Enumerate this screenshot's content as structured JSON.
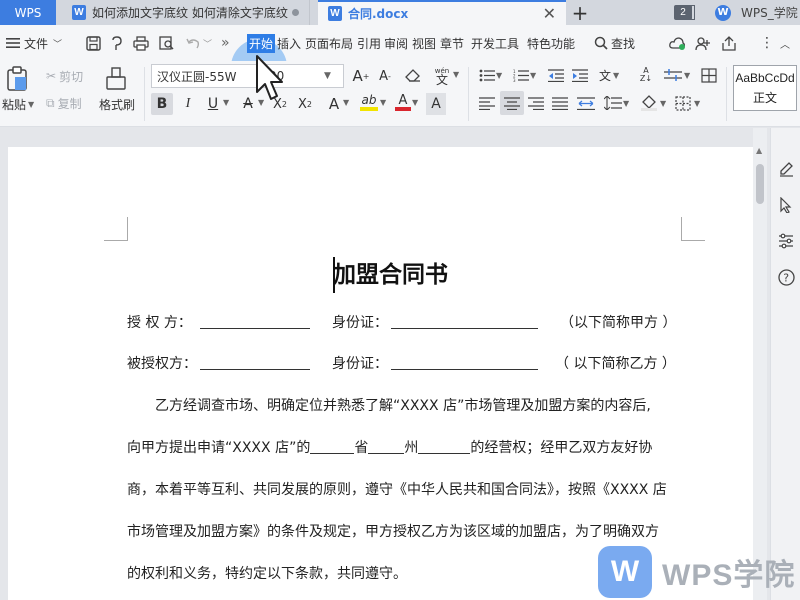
{
  "titlebar": {
    "app_tab": "WPS",
    "tab1_label": "如何添加文字底纹 如何清除文字底纹",
    "tab2_label": "合同.docx",
    "tab_add": "+",
    "page_count": "2",
    "account_label": "WPS_学院"
  },
  "menubar": {
    "file_label": "文件",
    "more": "»",
    "tabs": [
      "开始",
      "插入",
      "页面布局",
      "引用",
      "审阅",
      "视图",
      "章节",
      "开发工具",
      "特色功能"
    ],
    "active_tab": "开始",
    "search_label": "查找"
  },
  "ribbon": {
    "paste_label": "粘贴",
    "cut_label": "剪切",
    "copy_label": "复制",
    "format_painter_label": "格式刷",
    "font_name": "汉仪正圆-55W",
    "font_size": "20",
    "style_sample": "AaBbCcDd",
    "style_label": "正文",
    "colors": {
      "highlight": "#f2e400",
      "font_color": "#d9262e"
    }
  },
  "document": {
    "title": "加盟合同书",
    "line1": {
      "a": "授 权 方：",
      "b": "身份证：",
      "c": "（以下简称甲方 ）"
    },
    "line2": {
      "a": "被授权方：",
      "b": "身份证：",
      "c": "（ 以下简称乙方 ）"
    },
    "para1": "乙方经调查市场、明确定位并熟悉了解“XXXX 店”市场管理及加盟方案的内容后,",
    "para2": {
      "a": "向甲方提出申请“XXXX 店”的",
      "b": "省",
      "c": "州",
      "d": "的经营权；经甲乙双方友好协"
    },
    "para3": "商，本着平等互利、共同发展的原则，遵守《中华人民共和国合同法》，按照《XXXX 店",
    "para4": "市场管理及加盟方案》的条件及规定，甲方授权乙方为该区域的加盟店，为了明确双方",
    "para5": "的权利和义务，特约定以下条款，共同遵守。"
  },
  "watermark": {
    "logo": "W",
    "text": "WPS学院"
  }
}
